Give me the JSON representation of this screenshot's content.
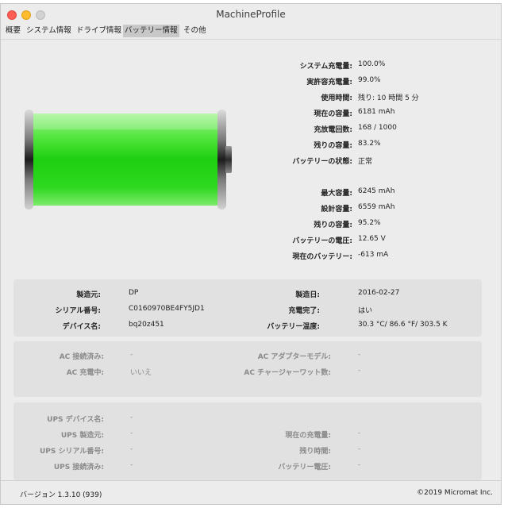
{
  "window": {
    "title": "MachineProfile"
  },
  "tabs": [
    "概要",
    "システム情報",
    "ドライブ情報",
    "バッテリー情報",
    "その他"
  ],
  "battery_icon": {
    "charge_fraction": 1.0,
    "fill_color": "#22d622"
  },
  "stats": [
    {
      "label": "システム充電量:",
      "value": "100.0%"
    },
    {
      "label": "実許容充電量:",
      "value": "99.0%"
    },
    {
      "label": "使用時間:",
      "value": "残り: 10 時間 5 分"
    },
    {
      "label": "現在の容量:",
      "value": "6181 mAh"
    },
    {
      "label": "充放電回数:",
      "value": "168 / 1000"
    },
    {
      "label": "残りの容量:",
      "value": "83.2%"
    },
    {
      "label": "バッテリーの状態:",
      "value": "正常"
    },
    {
      "label": "最大容量:",
      "value": "6245 mAh"
    },
    {
      "label": "設計容量:",
      "value": "6559 mAh"
    },
    {
      "label": "残りの容量:",
      "value": "95.2%"
    },
    {
      "label": "バッテリーの電圧:",
      "value": "12.65 V"
    },
    {
      "label": "現在のバッテリー:",
      "value": "-613 mA"
    }
  ],
  "info": {
    "left": [
      {
        "label": "製造元:",
        "value": "DP"
      },
      {
        "label": "シリアル番号:",
        "value": "C0160970BE4FY5JD1"
      },
      {
        "label": "デバイス名:",
        "value": "bq20z451"
      }
    ],
    "right": [
      {
        "label": "製造日:",
        "value": "2016-02-27"
      },
      {
        "label": "充電完了:",
        "value": "はい"
      },
      {
        "label": "バッテリー温度:",
        "value": "30.3 °C/ 86.6 °F/ 303.5 K"
      }
    ]
  },
  "ac": {
    "left": [
      {
        "label": "AC 接続済み:",
        "value": "-"
      },
      {
        "label": "AC 充電中:",
        "value": "いいえ"
      }
    ],
    "right": [
      {
        "label": "AC アダプターモデル:",
        "value": "-"
      },
      {
        "label": "AC チャージャーワット数:",
        "value": "-"
      }
    ]
  },
  "ups": {
    "left": [
      {
        "label": "UPS デバイス名:",
        "value": "-"
      },
      {
        "label": "UPS 製造元:",
        "value": "-"
      },
      {
        "label": "UPS シリアル番号:",
        "value": "-"
      },
      {
        "label": "UPS 接続済み:",
        "value": "-"
      }
    ],
    "right": [
      {
        "label": "現在の充電量:",
        "value": "-"
      },
      {
        "label": "残り時間:",
        "value": "-"
      },
      {
        "label": "バッテリー電圧:",
        "value": "-"
      }
    ]
  },
  "footer": {
    "version": "バージョン 1.3.10 (939)",
    "copyright": "©2019 Micromat Inc."
  }
}
